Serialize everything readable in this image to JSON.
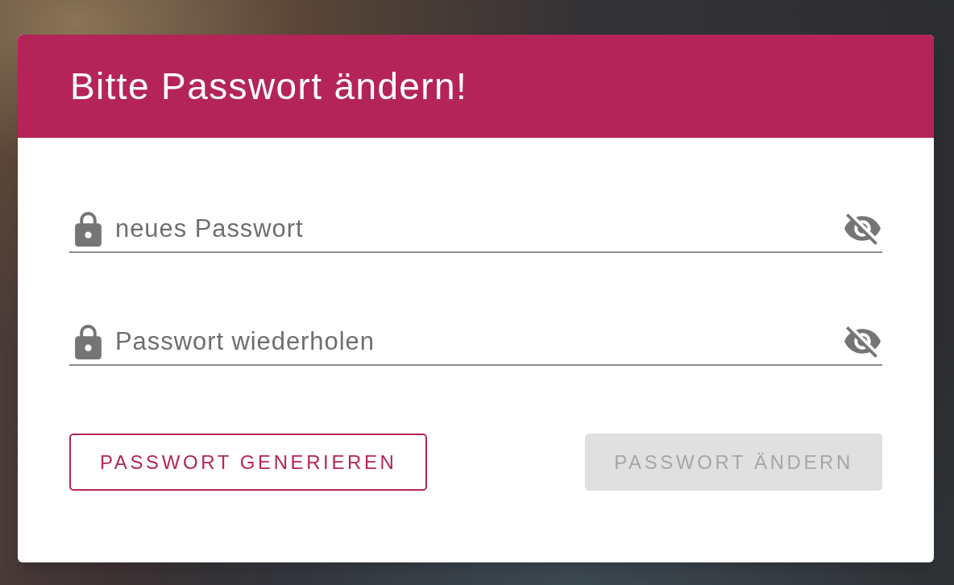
{
  "dialog": {
    "title": "Bitte Passwort ändern!",
    "fields": [
      {
        "placeholder": "neues Passwort",
        "revealed": false
      },
      {
        "placeholder": "Passwort wiederholen",
        "revealed": false
      }
    ],
    "buttons": [
      {
        "label": "PASSWORT GENERIEREN",
        "kind": "outlined",
        "disabled": false
      },
      {
        "label": "PASSWORT ÄNDERN",
        "kind": "contained",
        "disabled": true
      }
    ]
  }
}
